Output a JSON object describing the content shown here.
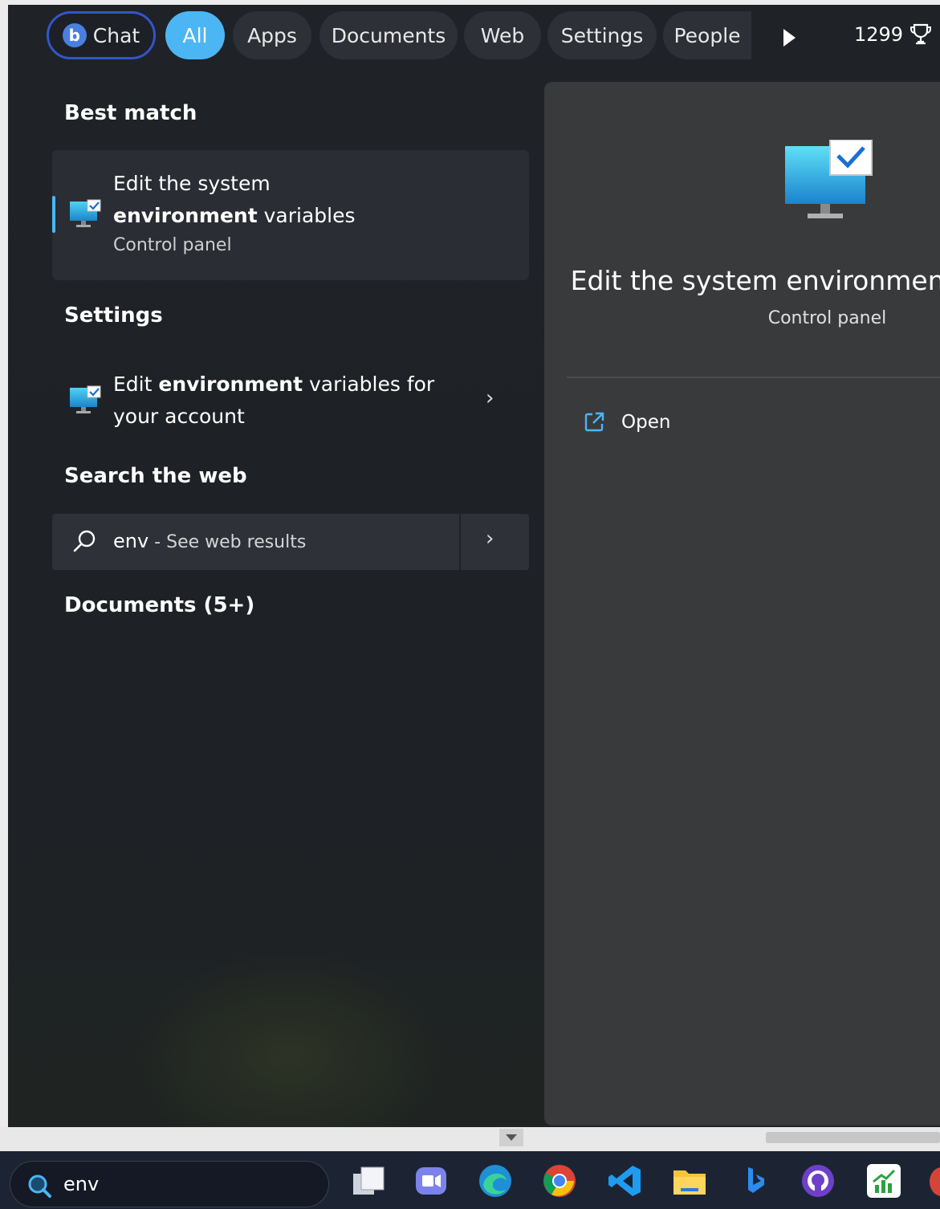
{
  "filters": {
    "chat": "Chat",
    "all": "All",
    "apps": "Apps",
    "documents": "Documents",
    "web": "Web",
    "settings": "Settings",
    "people": "People",
    "points": "1299"
  },
  "left": {
    "best_match_heading": "Best match",
    "best_match": {
      "title_pre": "Edit the system ",
      "title_bold": "environment",
      "title_post": " variables",
      "subtitle": "Control panel"
    },
    "settings_heading": "Settings",
    "settings_item": {
      "title_pre": "Edit ",
      "title_bold": "environment",
      "title_post": " variables for your account"
    },
    "web_heading": "Search the web",
    "web_item": {
      "query": "env",
      "suffix": " - See web results"
    },
    "documents_heading": "Documents (5+)"
  },
  "preview": {
    "title": "Edit the system environment variables",
    "subtitle": "Control panel",
    "open_label": "Open"
  },
  "taskbar": {
    "search_value": "env",
    "apps": [
      "task-view",
      "teams-chat",
      "edge",
      "chrome",
      "vscode",
      "file-explorer",
      "bing",
      "github-desktop",
      "stocks-app"
    ]
  },
  "colors": {
    "accent": "#4cb6f5",
    "chat_border": "#3355c8",
    "panel_bg": "#1f2227",
    "preview_bg": "#393a3c",
    "taskbar_bg": "#1c2434"
  }
}
